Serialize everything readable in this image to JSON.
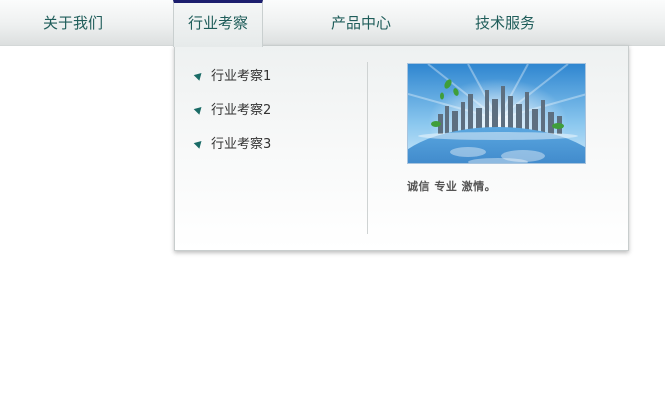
{
  "nav": {
    "items": [
      {
        "label": "关于我们"
      },
      {
        "label": "行业考察"
      },
      {
        "label": "产品中心"
      },
      {
        "label": "技术服务"
      }
    ],
    "active_index": 1
  },
  "dropdown": {
    "items": [
      {
        "label": "行业考察1"
      },
      {
        "label": "行业考察2"
      },
      {
        "label": "行业考察3"
      }
    ],
    "image_icon": "globe-city-skyline-image",
    "slogan": "诚信  专业  激情。"
  },
  "colors": {
    "nav_text": "#1f5d5a",
    "active_tab_border": "#1c1e6e",
    "bullet": "#1a6b66",
    "menu_text": "#333333"
  }
}
